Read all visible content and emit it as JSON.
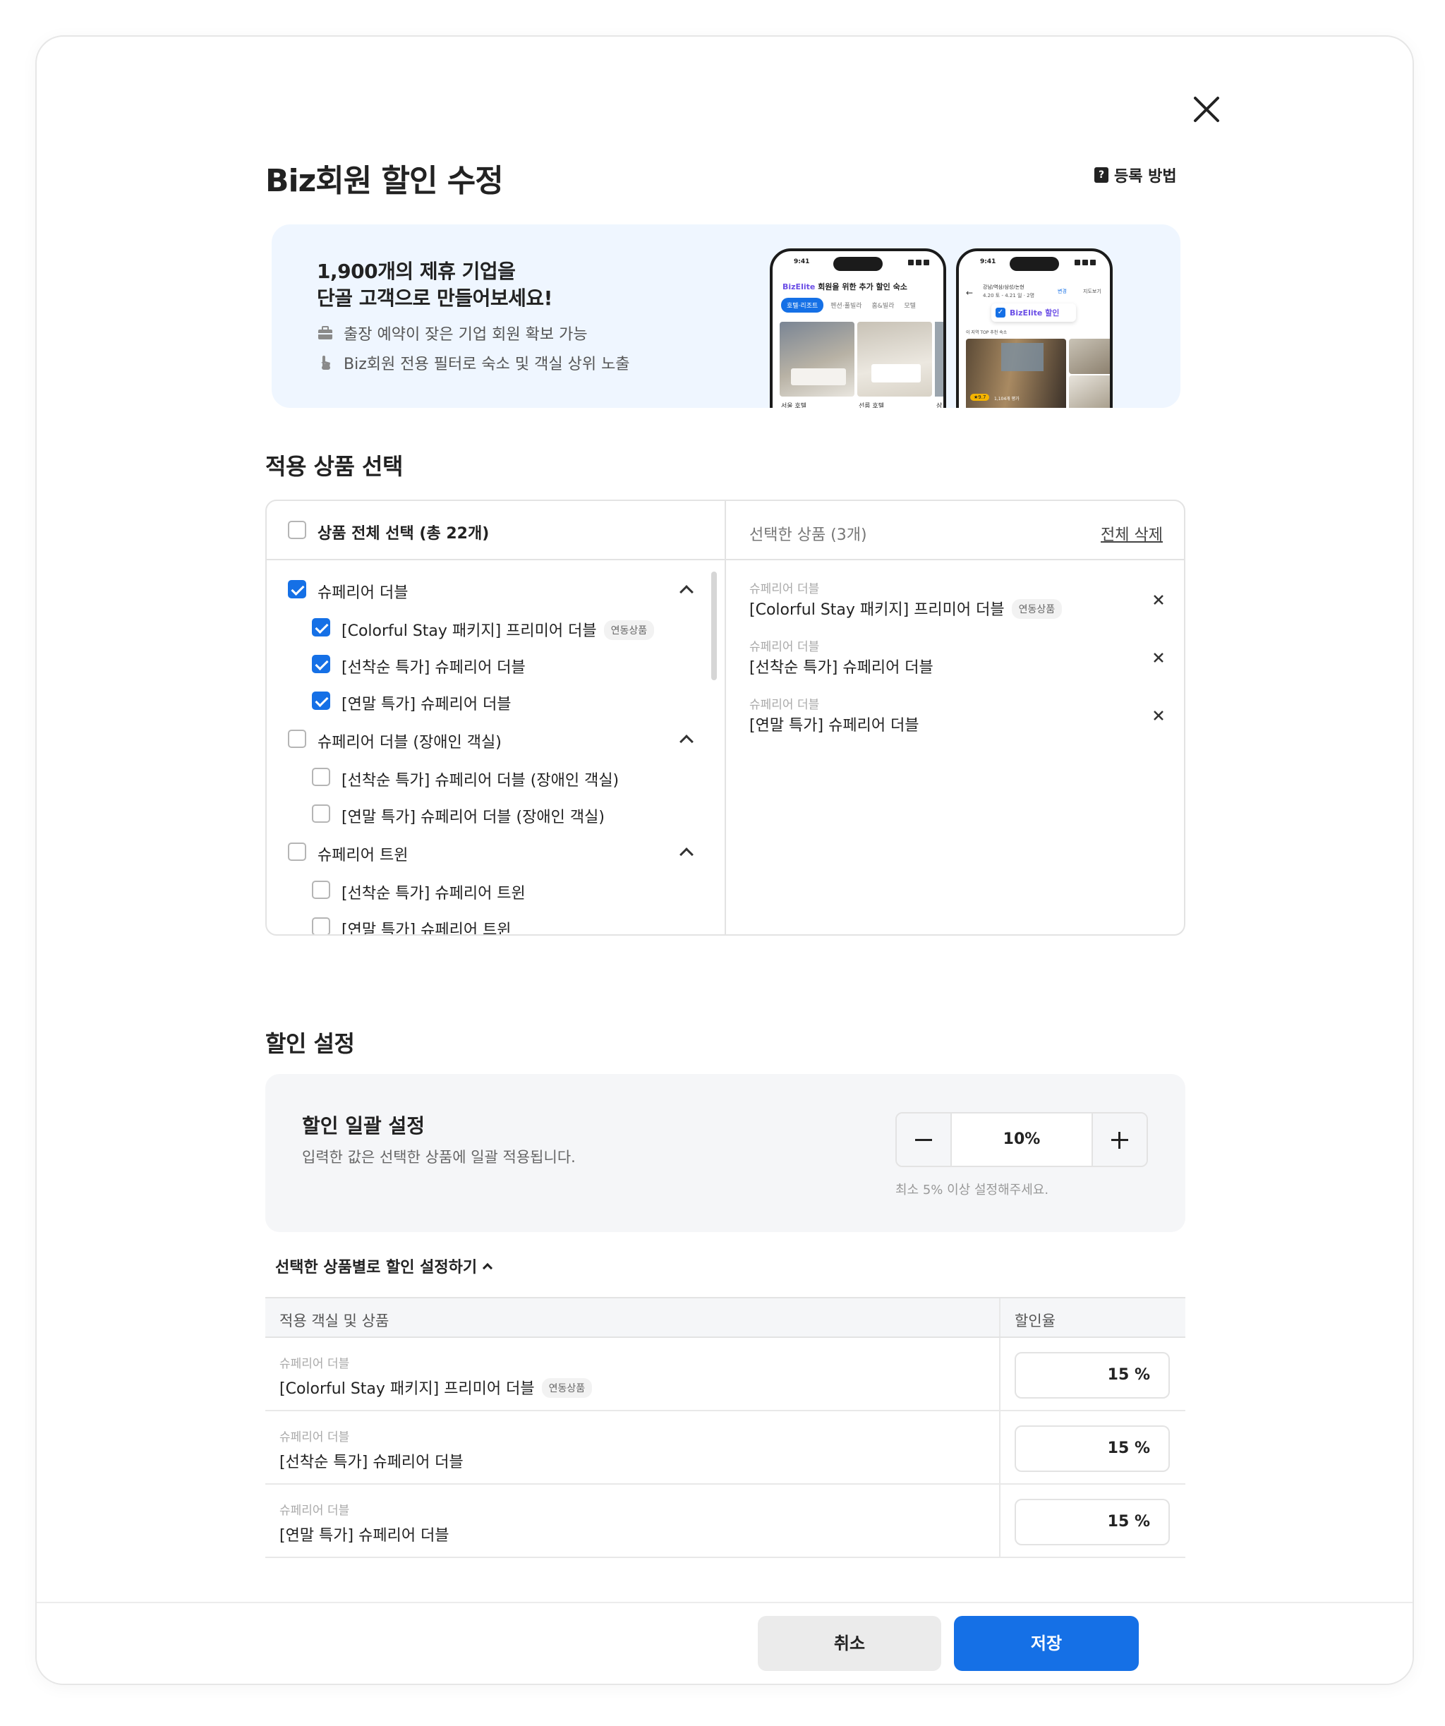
{
  "dialog": {
    "title": "Biz회원 할인 수정",
    "howto_label": "등록 방법"
  },
  "banner": {
    "headline": "1,900개의 제휴 기업을\n단골 고객으로 만들어보세요!",
    "bullets": [
      {
        "icon": "briefcase-icon",
        "text": "출장 예약이 잦은 기업 회원 확보 가능"
      },
      {
        "icon": "tap-hand-icon",
        "text": "Biz회원 전용 필터로 숙소 및 객실 상위 노출"
      }
    ],
    "phone1": {
      "time": "9:41",
      "brand": "BizElite",
      "heading": "회원을 위한 추가 할인 숙소",
      "tabs": [
        "호텔·리조트",
        "펜션·풀빌라",
        "홈&빌라",
        "모텔"
      ],
      "cards": [
        "서울 호텔",
        "선릉 호텔",
        "삼"
      ]
    },
    "phone2": {
      "time": "9:41",
      "location": "강남/역삼/삼성/논현",
      "dates": "4.20 토 - 4.21 일 · 2명",
      "change": "변경",
      "map": "지도보기",
      "badge": "BizElite 할인",
      "section": "이 지역 TOP 추천 숙소",
      "rating": "9.7",
      "reviews": "1,104개 평가"
    },
    "colors": {
      "background": "#eff6ff",
      "accent": "#1570e6",
      "brand_purple": "#6b4ee6"
    }
  },
  "product_section": {
    "title": "적용 상품 선택",
    "select_all_label": "상품 전체 선택 (총 22개)",
    "select_all_checked": false,
    "groups": [
      {
        "label": "슈페리어 더블",
        "checked": true,
        "expanded": true,
        "items": [
          {
            "label": "[Colorful Stay 패키지] 프리미어 더블",
            "tag": "연동상품",
            "checked": true
          },
          {
            "label": "[선착순 특가] 슈페리어 더블",
            "tag": "",
            "checked": true
          },
          {
            "label": "[연말 특가] 슈페리어 더블",
            "tag": "",
            "checked": true
          }
        ]
      },
      {
        "label": "슈페리어 더블 (장애인 객실)",
        "checked": false,
        "expanded": true,
        "items": [
          {
            "label": "[선착순 특가] 슈페리어 더블 (장애인 객실)",
            "tag": "",
            "checked": false
          },
          {
            "label": "[연말 특가] 슈페리어 더블 (장애인 객실)",
            "tag": "",
            "checked": false
          }
        ]
      },
      {
        "label": "슈페리어 트윈",
        "checked": false,
        "expanded": true,
        "items": [
          {
            "label": "[선착순 특가] 슈페리어 트윈",
            "tag": "",
            "checked": false
          },
          {
            "label": "[연말 특가] 슈페리어 트윈",
            "tag": "",
            "checked": false
          }
        ]
      }
    ],
    "selected_title": "선택한 상품 (3개)",
    "clear_all_label": "전체 삭제",
    "selected": [
      {
        "category": "슈페리어 더블",
        "name": "[Colorful Stay 패키지] 프리미어 더블",
        "tag": "연동상품"
      },
      {
        "category": "슈페리어 더블",
        "name": "[선착순 특가] 슈페리어 더블",
        "tag": ""
      },
      {
        "category": "슈페리어 더블",
        "name": "[연말 특가] 슈페리어 더블",
        "tag": ""
      }
    ]
  },
  "discount_section": {
    "title": "할인 설정",
    "bulk_title": "할인 일괄 설정",
    "bulk_desc": "입력한 값은 선택한 상품에 일괄 적용됩니다.",
    "bulk_value": "10%",
    "bulk_hint": "최소 5% 이상 설정해주세요.",
    "per_item_toggle": "선택한 상품별로 할인 설정하기",
    "table_headers": [
      "적용 객실 및 상품",
      "할인율"
    ],
    "rows": [
      {
        "category": "슈페리어 더블",
        "name": "[Colorful Stay 패키지] 프리미어 더블",
        "tag": "연동상품",
        "rate": "15 %"
      },
      {
        "category": "슈페리어 더블",
        "name": "[선착순 특가] 슈페리어 더블",
        "tag": "",
        "rate": "15 %"
      },
      {
        "category": "슈페리어 더블",
        "name": "[연말 특가] 슈페리어 더블",
        "tag": "",
        "rate": "15 %"
      }
    ]
  },
  "footer": {
    "cancel_label": "취소",
    "save_label": "저장"
  }
}
